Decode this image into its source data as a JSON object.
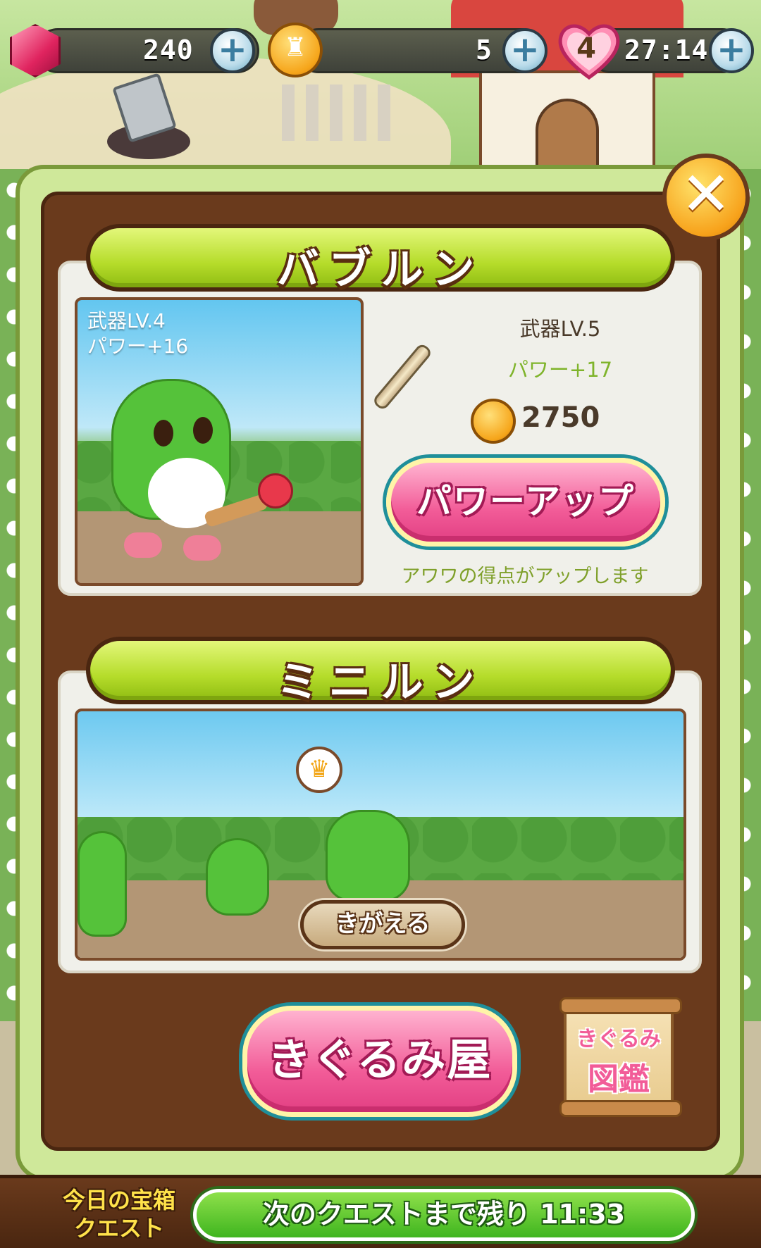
{
  "resources": {
    "gems": "240",
    "coins": "5",
    "hearts": "4",
    "heart_timer": "27:14",
    "plus_glyph": "+"
  },
  "close_glyph": "✕",
  "bubblun": {
    "title": "バブルン",
    "current_level": "武器LV.4",
    "current_power": "パワー+16",
    "next_level": "武器LV.5",
    "next_power": "パワー+17",
    "cost": "2750",
    "powerup_label": "パワーアップ",
    "powerup_note": "アワワの得点がアップします"
  },
  "minirun": {
    "title": "ミニルン",
    "change_label": "きがえる",
    "crown_glyph": "♛"
  },
  "kigurumi_shop_label": "きぐるみ屋",
  "kigurumi_book": {
    "line1": "きぐるみ",
    "line2": "図鑑"
  },
  "quest": {
    "label_line1": "今日の宝箱",
    "label_line2": "クエスト",
    "timer_text": "次のクエストまで残り 11:33"
  },
  "colors": {
    "accent_pink": "#f25c98",
    "ribbon_green": "#b5dc2a",
    "panel_brown": "#6a3a1c"
  },
  "icons": [
    "gem-icon",
    "coin-icon",
    "heart-icon",
    "plus-icon",
    "close-icon",
    "bat-icon",
    "crown-icon",
    "scroll-icon"
  ]
}
